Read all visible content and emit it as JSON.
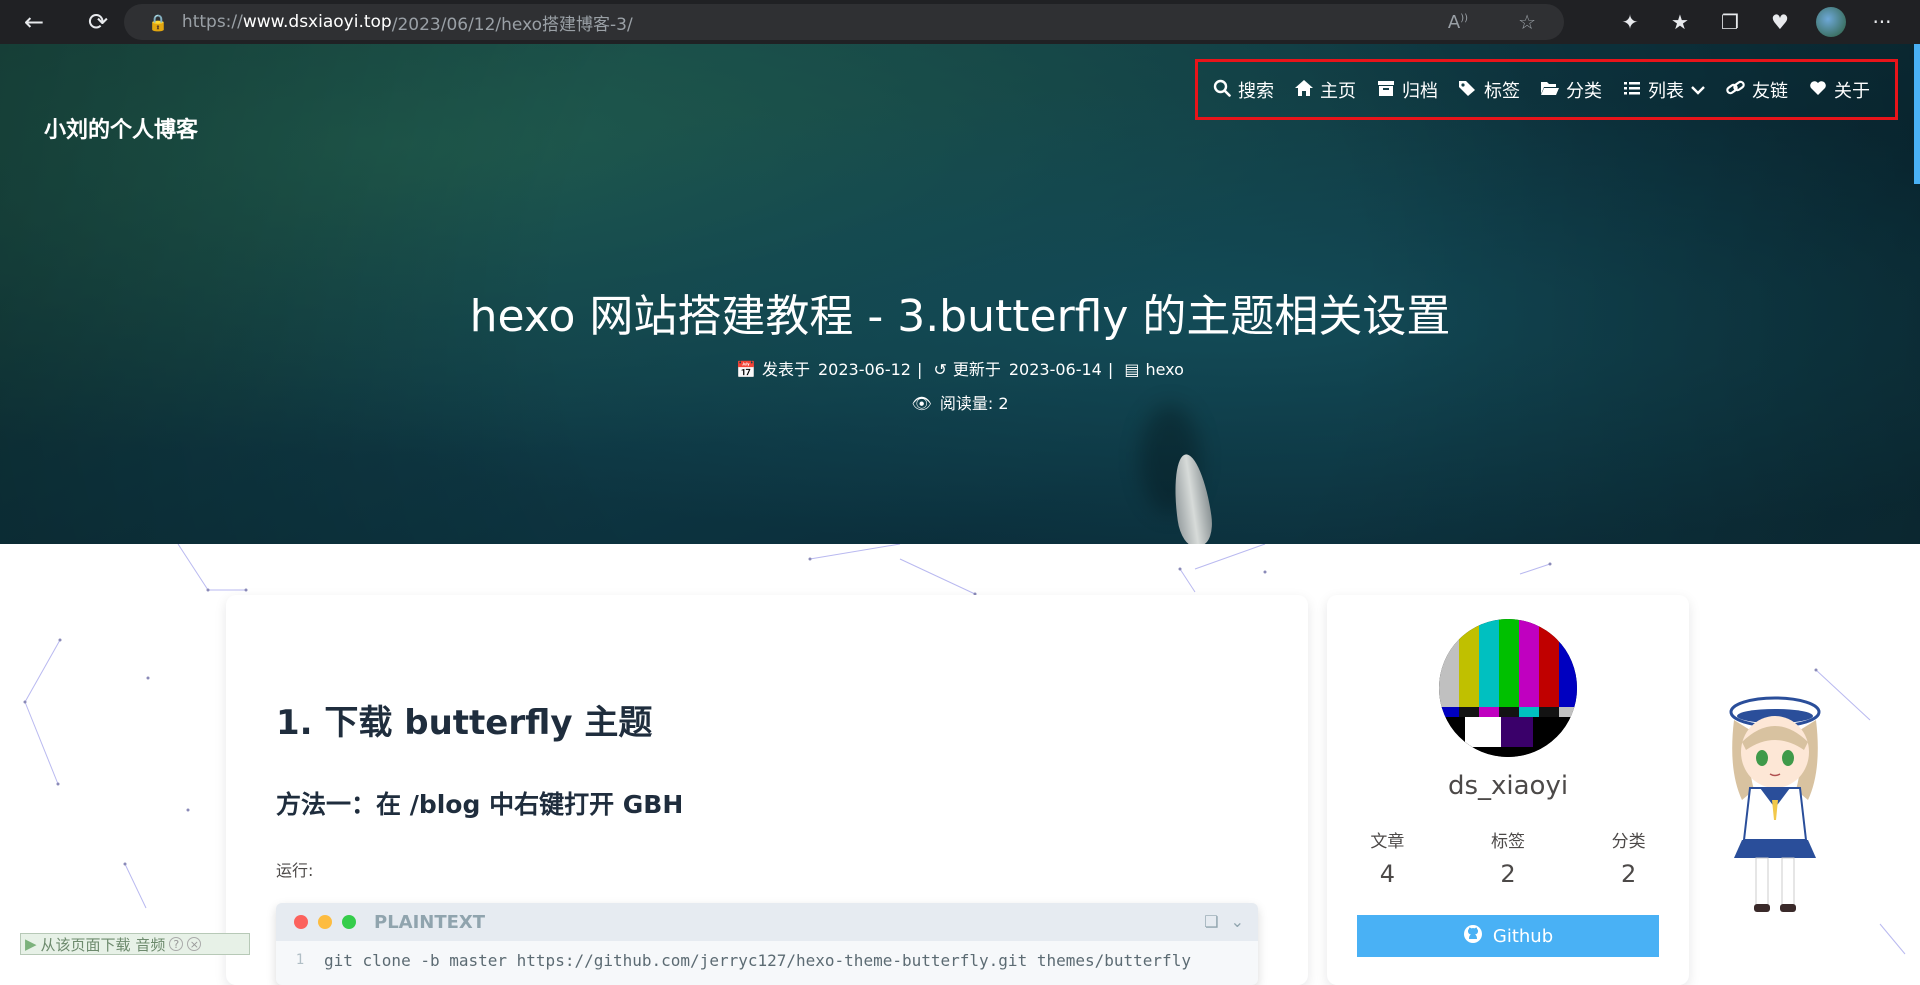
{
  "browser": {
    "url_prefix": "https://",
    "url_host": "www.dsxiaoyi.top",
    "url_path": "/2023/06/12/hexo搭建博客-3/",
    "read_aloud_label": "A",
    "more_label": "···"
  },
  "site": {
    "name": "小刘的个人博客"
  },
  "menu": {
    "items": [
      {
        "label": "搜索",
        "icon": "search-icon"
      },
      {
        "label": "主页",
        "icon": "home-icon"
      },
      {
        "label": "归档",
        "icon": "archive-icon"
      },
      {
        "label": "标签",
        "icon": "tags-icon"
      },
      {
        "label": "分类",
        "icon": "folder-open-icon"
      },
      {
        "label": "列表",
        "icon": "list-icon"
      },
      {
        "label": "友链",
        "icon": "link-icon"
      },
      {
        "label": "关于",
        "icon": "heart-icon"
      }
    ],
    "highlight_color": "#e8141a"
  },
  "post": {
    "title": "hexo 网站搭建教程 - 3.butterfly 的主题相关设置",
    "published_label": "发表于",
    "published_date": "2023-06-12",
    "updated_label": "更新于",
    "updated_date": "2023-06-14",
    "category": "hexo",
    "views_label": "阅读量:",
    "views": "2"
  },
  "article": {
    "h1": "1. 下载 butterfly 主题",
    "h2": "方法一：在 /blog 中右键打开 GBH",
    "paragraph": "运行:",
    "code_lang": "PLAINTEXT",
    "code_line_no": "1",
    "code_text": "git clone -b master https://github.com/jerryc127/hexo-theme-butterfly.git themes/butterfly"
  },
  "author": {
    "name": "ds_xiaoyi",
    "stats": [
      {
        "label": "文章",
        "value": "4"
      },
      {
        "label": "标签",
        "value": "2"
      },
      {
        "label": "分类",
        "value": "2"
      }
    ],
    "github_label": "Github",
    "accent": "#49b1f5"
  },
  "download_bar": {
    "label": "从该页面下载 音频"
  }
}
